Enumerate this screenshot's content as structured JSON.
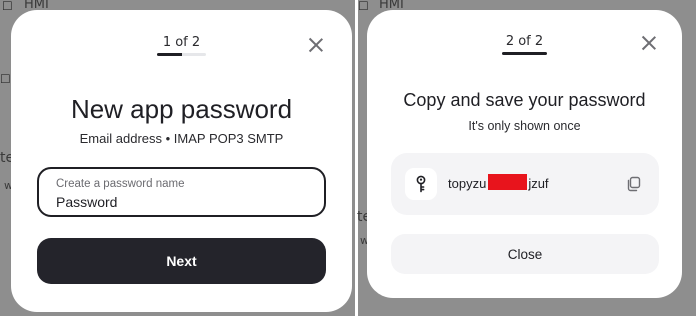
{
  "background": {
    "snippets": [
      "HMI",
      "HMI",
      "te",
      "w",
      "te",
      "w"
    ]
  },
  "step1": {
    "step_label": "1 of 2",
    "progress": 0.5,
    "title": "New app password",
    "subtitle": "Email address • IMAP POP3 SMTP",
    "field": {
      "label": "Create a password name",
      "value": "Password"
    },
    "next_label": "Next",
    "close_icon": "close-icon"
  },
  "step2": {
    "step_label": "2 of 2",
    "progress": 1.0,
    "title": "Copy and save your password",
    "subtitle": "It's only shown once",
    "password": {
      "prefix": "topyzu",
      "suffix": "jzuf"
    },
    "close_label": "Close",
    "close_icon": "close-icon",
    "key_icon": "key-icon",
    "copy_icon": "copy-icon"
  },
  "colors": {
    "primary_button": "#24242b",
    "redaction": "#e8141c",
    "card_bg": "#f4f4f6"
  }
}
